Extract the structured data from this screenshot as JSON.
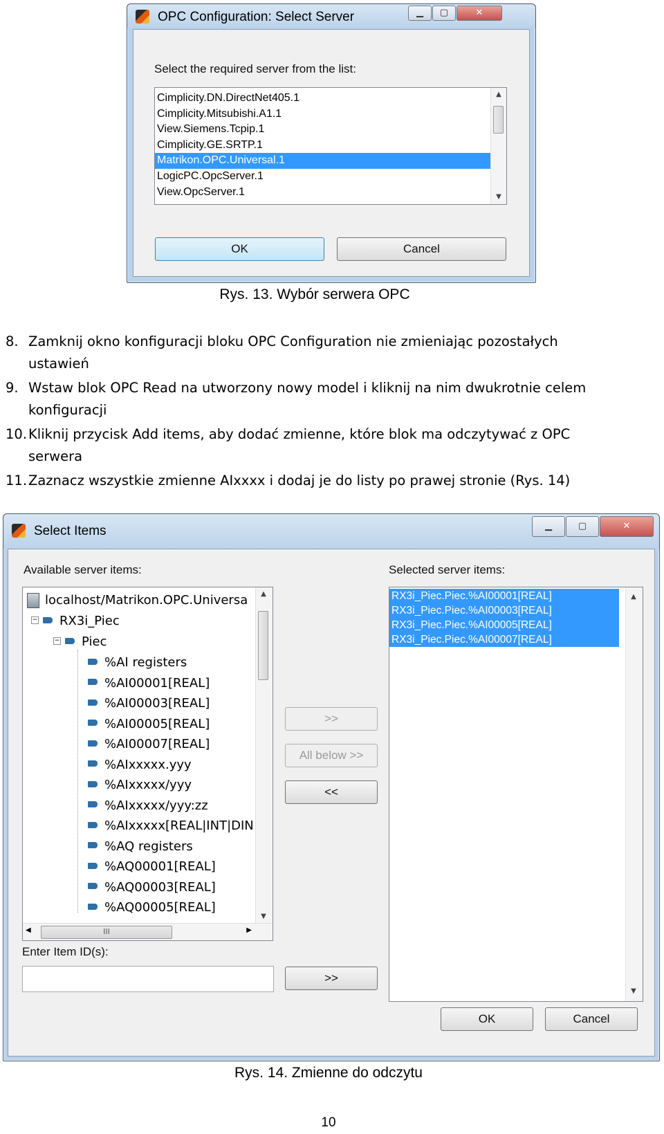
{
  "dialog1": {
    "title": "OPC Configuration: Select Server",
    "prompt": "Select the required server from the list:",
    "servers": [
      "Cimplicity.DN.DirectNet405.1",
      "Cimplicity.Mitsubishi.A1.1",
      "View.Siemens.Tcpip.1",
      "Cimplicity.GE.SRTP.1",
      "Matrikon.OPC.Universal.1",
      "LogicPC.OpcServer.1",
      "View.OpcServer.1"
    ],
    "selected_index": 4,
    "ok_label": "OK",
    "cancel_label": "Cancel"
  },
  "caption1": "Rys. 13. Wybór serwera OPC",
  "steps": [
    {
      "num": "8.",
      "line1": "Zamknij okno konfiguracji bloku OPC Configuration nie zmieniając pozostałych",
      "line2": "ustawień"
    },
    {
      "num": "9.",
      "line1": "Wstaw blok OPC Read na utworzony nowy model i kliknij na nim dwukrotnie celem",
      "line2": "konfiguracji"
    },
    {
      "num": "10.",
      "line1": "Kliknij przycisk Add items, aby dodać zmienne, które blok ma odczytywać z OPC",
      "line2": "serwera"
    },
    {
      "num": "11.",
      "line1": "Zaznacz wszystkie zmienne AIxxxx i dodaj je do listy po prawej stronie (Rys. 14)"
    }
  ],
  "dialog2": {
    "title": "Select Items",
    "available_label": "Available server items:",
    "selected_label": "Selected server items:",
    "tree": {
      "root": "localhost/Matrikon.OPC.Universa",
      "node1": "RX3i_Piec",
      "node2": "Piec",
      "items": [
        "%AI registers",
        "%AI00001[REAL]",
        "%AI00003[REAL]",
        "%AI00005[REAL]",
        "%AI00007[REAL]",
        "%AIxxxxx.yyy",
        "%AIxxxxx/yyy",
        "%AIxxxxx/yyy:zz",
        "%AIxxxxx[REAL|INT|DIN",
        "%AQ registers",
        "%AQ00001[REAL]",
        "%AQ00003[REAL]",
        "%AQ00005[REAL]"
      ]
    },
    "selected_items": [
      "RX3i_Piec.Piec.%AI00001[REAL]",
      "RX3i_Piec.Piec.%AI00003[REAL]",
      "RX3i_Piec.Piec.%AI00005[REAL]",
      "RX3i_Piec.Piec.%AI00007[REAL]"
    ],
    "add_label": ">>",
    "all_below_label": "All below >>",
    "remove_label": "<<",
    "enter_id_label": "Enter Item ID(s):",
    "enter_add_label": ">>",
    "ok_label": "OK",
    "cancel_label": "Cancel",
    "hscroll_grip": "III"
  },
  "caption2": "Rys. 14. Zmienne do odczytu",
  "page_number": "10"
}
